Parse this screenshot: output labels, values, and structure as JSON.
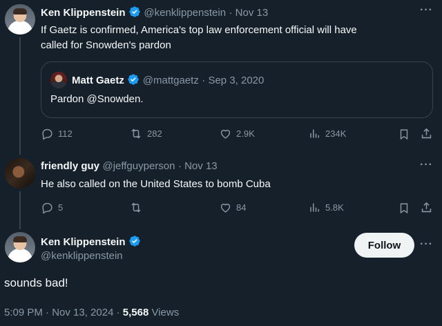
{
  "tweet1": {
    "name": "Ken Klippenstein",
    "handle": "@kenklippenstein",
    "date": "· Nov 13",
    "text_line1": "If Gaetz is confirmed, America's top law enforcement official will have",
    "text_line2": "called for Snowden's pardon",
    "quote": {
      "name": "Matt Gaetz",
      "handle": "@mattgaetz",
      "date": "· Sep 3, 2020",
      "text": "Pardon @Snowden."
    },
    "stats": {
      "replies": "112",
      "reposts": "282",
      "likes": "2.9K",
      "views": "234K"
    }
  },
  "tweet2": {
    "name": "friendly guy",
    "handle": "@jeffguyperson",
    "date": "· Nov 13",
    "text": "He also called on the United States to bomb Cuba",
    "stats": {
      "replies": "5",
      "reposts": "",
      "likes": "84",
      "views": "5.8K"
    }
  },
  "main": {
    "name": "Ken Klippenstein",
    "handle": "@kenklippenstein",
    "follow_label": "Follow",
    "text": "sounds bad!",
    "time": "5:09 PM · Nov 13, 2024 ·",
    "views_count": "5,568",
    "views_label": "Views"
  },
  "icons": {
    "verified": "verified-badge-icon",
    "more": "more-icon",
    "reply": "reply-icon",
    "repost": "repost-icon",
    "like": "like-icon",
    "views": "views-icon",
    "bookmark": "bookmark-icon",
    "share": "share-icon"
  },
  "colors": {
    "background": "#15202b",
    "verified": "#1d9bf0",
    "muted": "#8b98a5",
    "border": "#38444d"
  }
}
